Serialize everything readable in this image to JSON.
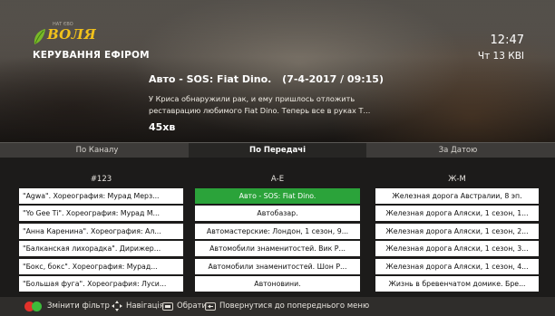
{
  "brand": {
    "name": "ВОЛЯ",
    "tagline": "НАТ ЄВО"
  },
  "header": {
    "title": "КЕРУВАННЯ ЕФІРОМ",
    "time": "12:47",
    "date": "Чт 13 КВІ"
  },
  "program": {
    "title": "Авто - SOS: Fiat Dino.",
    "airing": "(7-4-2017 / 09:15)",
    "description": "У Криса обнаружили рак, и ему пришлось отложить реставрацию любимого Fiat Dino. Теперь все в руках Т...",
    "duration": "45хв"
  },
  "tabs": [
    {
      "label": "По Каналу",
      "active": false
    },
    {
      "label": "По Передачі",
      "active": true
    },
    {
      "label": "За Датою",
      "active": false
    }
  ],
  "columns": [
    {
      "header": "#123",
      "items": [
        "\"Agwa\". Хореография: Мурад Мерз...",
        "\"Yo Gee Ti\". Хореография: Мурад М...",
        "\"Анна Каренина\". Хореография: Ал...",
        "\"Балканская лихорадка\". Дирижер...",
        "\"Бокс, бокс\". Хореография: Мурад...",
        "\"Большая фуга\". Хореография: Луси..."
      ]
    },
    {
      "header": "А-Е",
      "items": [
        "Авто - SOS: Fiat Dino.",
        "Автобазар.",
        "Автомастерские: Лондон, 1 сезон, 9...",
        "Автомобили знаменитостей. Вик Р...",
        "Автомобили знаменитостей. Шон Р...",
        "Автоновини."
      ],
      "selected_index": 0
    },
    {
      "header": "Ж-М",
      "items": [
        "Железная дорога Австралии, 8 эп.",
        "Железная дорога Аляски, 1 сезон, 1...",
        "Железная дорога Аляски, 1 сезон, 2...",
        "Железная дорога Аляски, 1 сезон, 3...",
        "Железная дорога Аляски, 1 сезон, 4...",
        "Жизнь в бревенчатом домике. Бре..."
      ]
    }
  ],
  "footer": {
    "change_filter": "Змінити фільтр",
    "navigation": "Навігація",
    "select": "Обрати",
    "back": "Повернутися до попереднього меню"
  },
  "colors": {
    "accent_green": "#2ba33a",
    "logo_yellow": "#f2c21b",
    "red_key": "#e2312a",
    "green_key": "#3dbb3a"
  },
  "icons": [
    "logo-leaf-icon",
    "red-button-icon",
    "green-button-icon",
    "navigation-arrows-icon",
    "ok-button-icon",
    "back-button-icon"
  ]
}
